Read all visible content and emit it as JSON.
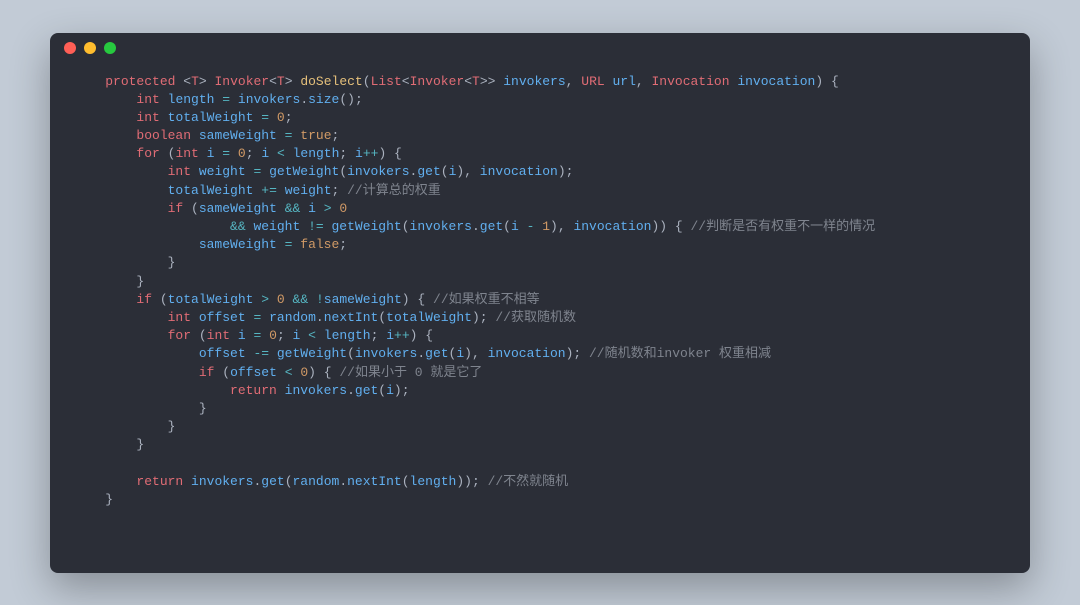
{
  "window": {
    "dots": {
      "red": "#ff5f56",
      "yellow": "#ffbd2e",
      "green": "#27c93f"
    }
  },
  "code": {
    "lines": [
      {
        "indent": 1,
        "tokens": [
          {
            "t": "kw",
            "v": "protected"
          },
          {
            "t": "sp",
            "v": " "
          },
          {
            "t": "punct",
            "v": "<"
          },
          {
            "t": "type",
            "v": "T"
          },
          {
            "t": "punct",
            "v": "> "
          },
          {
            "t": "type",
            "v": "Invoker"
          },
          {
            "t": "punct",
            "v": "<"
          },
          {
            "t": "type",
            "v": "T"
          },
          {
            "t": "punct",
            "v": "> "
          },
          {
            "t": "fn",
            "v": "doSelect"
          },
          {
            "t": "paren",
            "v": "("
          },
          {
            "t": "type",
            "v": "List"
          },
          {
            "t": "punct",
            "v": "<"
          },
          {
            "t": "type",
            "v": "Invoker"
          },
          {
            "t": "punct",
            "v": "<"
          },
          {
            "t": "type",
            "v": "T"
          },
          {
            "t": "punct",
            "v": ">> "
          },
          {
            "t": "var",
            "v": "invokers"
          },
          {
            "t": "punct",
            "v": ", "
          },
          {
            "t": "type",
            "v": "URL"
          },
          {
            "t": "sp",
            "v": " "
          },
          {
            "t": "var",
            "v": "url"
          },
          {
            "t": "punct",
            "v": ", "
          },
          {
            "t": "type",
            "v": "Invocation"
          },
          {
            "t": "sp",
            "v": " "
          },
          {
            "t": "var",
            "v": "invocation"
          },
          {
            "t": "paren",
            "v": ") {"
          }
        ]
      },
      {
        "indent": 2,
        "tokens": [
          {
            "t": "kw",
            "v": "int"
          },
          {
            "t": "sp",
            "v": " "
          },
          {
            "t": "var",
            "v": "length"
          },
          {
            "t": "sp",
            "v": " "
          },
          {
            "t": "op",
            "v": "="
          },
          {
            "t": "sp",
            "v": " "
          },
          {
            "t": "var",
            "v": "invokers"
          },
          {
            "t": "punct",
            "v": "."
          },
          {
            "t": "call",
            "v": "size"
          },
          {
            "t": "paren",
            "v": "();"
          }
        ]
      },
      {
        "indent": 2,
        "tokens": [
          {
            "t": "kw",
            "v": "int"
          },
          {
            "t": "sp",
            "v": " "
          },
          {
            "t": "var",
            "v": "totalWeight"
          },
          {
            "t": "sp",
            "v": " "
          },
          {
            "t": "op",
            "v": "="
          },
          {
            "t": "sp",
            "v": " "
          },
          {
            "t": "num",
            "v": "0"
          },
          {
            "t": "punct",
            "v": ";"
          }
        ]
      },
      {
        "indent": 2,
        "tokens": [
          {
            "t": "kw",
            "v": "boolean"
          },
          {
            "t": "sp",
            "v": " "
          },
          {
            "t": "var",
            "v": "sameWeight"
          },
          {
            "t": "sp",
            "v": " "
          },
          {
            "t": "op",
            "v": "="
          },
          {
            "t": "sp",
            "v": " "
          },
          {
            "t": "bool",
            "v": "true"
          },
          {
            "t": "punct",
            "v": ";"
          }
        ]
      },
      {
        "indent": 2,
        "tokens": [
          {
            "t": "kw",
            "v": "for"
          },
          {
            "t": "sp",
            "v": " "
          },
          {
            "t": "paren",
            "v": "("
          },
          {
            "t": "kw",
            "v": "int"
          },
          {
            "t": "sp",
            "v": " "
          },
          {
            "t": "var",
            "v": "i"
          },
          {
            "t": "sp",
            "v": " "
          },
          {
            "t": "op",
            "v": "="
          },
          {
            "t": "sp",
            "v": " "
          },
          {
            "t": "num",
            "v": "0"
          },
          {
            "t": "punct",
            "v": "; "
          },
          {
            "t": "var",
            "v": "i"
          },
          {
            "t": "sp",
            "v": " "
          },
          {
            "t": "op",
            "v": "<"
          },
          {
            "t": "sp",
            "v": " "
          },
          {
            "t": "var",
            "v": "length"
          },
          {
            "t": "punct",
            "v": "; "
          },
          {
            "t": "var",
            "v": "i"
          },
          {
            "t": "op",
            "v": "++"
          },
          {
            "t": "paren",
            "v": ") {"
          }
        ]
      },
      {
        "indent": 3,
        "tokens": [
          {
            "t": "kw",
            "v": "int"
          },
          {
            "t": "sp",
            "v": " "
          },
          {
            "t": "var",
            "v": "weight"
          },
          {
            "t": "sp",
            "v": " "
          },
          {
            "t": "op",
            "v": "="
          },
          {
            "t": "sp",
            "v": " "
          },
          {
            "t": "call",
            "v": "getWeight"
          },
          {
            "t": "paren",
            "v": "("
          },
          {
            "t": "var",
            "v": "invokers"
          },
          {
            "t": "punct",
            "v": "."
          },
          {
            "t": "call",
            "v": "get"
          },
          {
            "t": "paren",
            "v": "("
          },
          {
            "t": "var",
            "v": "i"
          },
          {
            "t": "paren",
            "v": "), "
          },
          {
            "t": "var",
            "v": "invocation"
          },
          {
            "t": "paren",
            "v": ");"
          }
        ]
      },
      {
        "indent": 3,
        "tokens": [
          {
            "t": "var",
            "v": "totalWeight"
          },
          {
            "t": "sp",
            "v": " "
          },
          {
            "t": "op",
            "v": "+="
          },
          {
            "t": "sp",
            "v": " "
          },
          {
            "t": "var",
            "v": "weight"
          },
          {
            "t": "punct",
            "v": "; "
          },
          {
            "t": "comment",
            "v": "//计算总的权重"
          }
        ]
      },
      {
        "indent": 3,
        "tokens": [
          {
            "t": "kw",
            "v": "if"
          },
          {
            "t": "sp",
            "v": " "
          },
          {
            "t": "paren",
            "v": "("
          },
          {
            "t": "var",
            "v": "sameWeight"
          },
          {
            "t": "sp",
            "v": " "
          },
          {
            "t": "op",
            "v": "&&"
          },
          {
            "t": "sp",
            "v": " "
          },
          {
            "t": "var",
            "v": "i"
          },
          {
            "t": "sp",
            "v": " "
          },
          {
            "t": "op",
            "v": ">"
          },
          {
            "t": "sp",
            "v": " "
          },
          {
            "t": "num",
            "v": "0"
          }
        ]
      },
      {
        "indent": 5,
        "tokens": [
          {
            "t": "op",
            "v": "&&"
          },
          {
            "t": "sp",
            "v": " "
          },
          {
            "t": "var",
            "v": "weight"
          },
          {
            "t": "sp",
            "v": " "
          },
          {
            "t": "op",
            "v": "!="
          },
          {
            "t": "sp",
            "v": " "
          },
          {
            "t": "call",
            "v": "getWeight"
          },
          {
            "t": "paren",
            "v": "("
          },
          {
            "t": "var",
            "v": "invokers"
          },
          {
            "t": "punct",
            "v": "."
          },
          {
            "t": "call",
            "v": "get"
          },
          {
            "t": "paren",
            "v": "("
          },
          {
            "t": "var",
            "v": "i"
          },
          {
            "t": "sp",
            "v": " "
          },
          {
            "t": "op",
            "v": "-"
          },
          {
            "t": "sp",
            "v": " "
          },
          {
            "t": "num",
            "v": "1"
          },
          {
            "t": "paren",
            "v": "), "
          },
          {
            "t": "var",
            "v": "invocation"
          },
          {
            "t": "paren",
            "v": ")) { "
          },
          {
            "t": "comment",
            "v": "//判断是否有权重不一样的情况"
          }
        ]
      },
      {
        "indent": 4,
        "tokens": [
          {
            "t": "var",
            "v": "sameWeight"
          },
          {
            "t": "sp",
            "v": " "
          },
          {
            "t": "op",
            "v": "="
          },
          {
            "t": "sp",
            "v": " "
          },
          {
            "t": "bool",
            "v": "false"
          },
          {
            "t": "punct",
            "v": ";"
          }
        ]
      },
      {
        "indent": 3,
        "tokens": [
          {
            "t": "paren",
            "v": "}"
          }
        ]
      },
      {
        "indent": 2,
        "tokens": [
          {
            "t": "paren",
            "v": "}"
          }
        ]
      },
      {
        "indent": 2,
        "tokens": [
          {
            "t": "kw",
            "v": "if"
          },
          {
            "t": "sp",
            "v": " "
          },
          {
            "t": "paren",
            "v": "("
          },
          {
            "t": "var",
            "v": "totalWeight"
          },
          {
            "t": "sp",
            "v": " "
          },
          {
            "t": "op",
            "v": ">"
          },
          {
            "t": "sp",
            "v": " "
          },
          {
            "t": "num",
            "v": "0"
          },
          {
            "t": "sp",
            "v": " "
          },
          {
            "t": "op",
            "v": "&&"
          },
          {
            "t": "sp",
            "v": " "
          },
          {
            "t": "op",
            "v": "!"
          },
          {
            "t": "var",
            "v": "sameWeight"
          },
          {
            "t": "paren",
            "v": ") { "
          },
          {
            "t": "comment",
            "v": "//如果权重不相等"
          }
        ]
      },
      {
        "indent": 3,
        "tokens": [
          {
            "t": "kw",
            "v": "int"
          },
          {
            "t": "sp",
            "v": " "
          },
          {
            "t": "var",
            "v": "offset"
          },
          {
            "t": "sp",
            "v": " "
          },
          {
            "t": "op",
            "v": "="
          },
          {
            "t": "sp",
            "v": " "
          },
          {
            "t": "var",
            "v": "random"
          },
          {
            "t": "punct",
            "v": "."
          },
          {
            "t": "call",
            "v": "nextInt"
          },
          {
            "t": "paren",
            "v": "("
          },
          {
            "t": "var",
            "v": "totalWeight"
          },
          {
            "t": "paren",
            "v": "); "
          },
          {
            "t": "comment",
            "v": "//获取随机数"
          }
        ]
      },
      {
        "indent": 3,
        "tokens": [
          {
            "t": "kw",
            "v": "for"
          },
          {
            "t": "sp",
            "v": " "
          },
          {
            "t": "paren",
            "v": "("
          },
          {
            "t": "kw",
            "v": "int"
          },
          {
            "t": "sp",
            "v": " "
          },
          {
            "t": "var",
            "v": "i"
          },
          {
            "t": "sp",
            "v": " "
          },
          {
            "t": "op",
            "v": "="
          },
          {
            "t": "sp",
            "v": " "
          },
          {
            "t": "num",
            "v": "0"
          },
          {
            "t": "punct",
            "v": "; "
          },
          {
            "t": "var",
            "v": "i"
          },
          {
            "t": "sp",
            "v": " "
          },
          {
            "t": "op",
            "v": "<"
          },
          {
            "t": "sp",
            "v": " "
          },
          {
            "t": "var",
            "v": "length"
          },
          {
            "t": "punct",
            "v": "; "
          },
          {
            "t": "var",
            "v": "i"
          },
          {
            "t": "op",
            "v": "++"
          },
          {
            "t": "paren",
            "v": ") {"
          }
        ]
      },
      {
        "indent": 4,
        "tokens": [
          {
            "t": "var",
            "v": "offset"
          },
          {
            "t": "sp",
            "v": " "
          },
          {
            "t": "op",
            "v": "-="
          },
          {
            "t": "sp",
            "v": " "
          },
          {
            "t": "call",
            "v": "getWeight"
          },
          {
            "t": "paren",
            "v": "("
          },
          {
            "t": "var",
            "v": "invokers"
          },
          {
            "t": "punct",
            "v": "."
          },
          {
            "t": "call",
            "v": "get"
          },
          {
            "t": "paren",
            "v": "("
          },
          {
            "t": "var",
            "v": "i"
          },
          {
            "t": "paren",
            "v": "), "
          },
          {
            "t": "var",
            "v": "invocation"
          },
          {
            "t": "paren",
            "v": "); "
          },
          {
            "t": "comment",
            "v": "//随机数和invoker 权重相减"
          }
        ]
      },
      {
        "indent": 4,
        "tokens": [
          {
            "t": "kw",
            "v": "if"
          },
          {
            "t": "sp",
            "v": " "
          },
          {
            "t": "paren",
            "v": "("
          },
          {
            "t": "var",
            "v": "offset"
          },
          {
            "t": "sp",
            "v": " "
          },
          {
            "t": "op",
            "v": "<"
          },
          {
            "t": "sp",
            "v": " "
          },
          {
            "t": "num",
            "v": "0"
          },
          {
            "t": "paren",
            "v": ") { "
          },
          {
            "t": "comment",
            "v": "//如果小于 0 就是它了"
          }
        ]
      },
      {
        "indent": 5,
        "tokens": [
          {
            "t": "kw",
            "v": "return"
          },
          {
            "t": "sp",
            "v": " "
          },
          {
            "t": "var",
            "v": "invokers"
          },
          {
            "t": "punct",
            "v": "."
          },
          {
            "t": "call",
            "v": "get"
          },
          {
            "t": "paren",
            "v": "("
          },
          {
            "t": "var",
            "v": "i"
          },
          {
            "t": "paren",
            "v": ");"
          }
        ]
      },
      {
        "indent": 4,
        "tokens": [
          {
            "t": "paren",
            "v": "}"
          }
        ]
      },
      {
        "indent": 3,
        "tokens": [
          {
            "t": "paren",
            "v": "}"
          }
        ]
      },
      {
        "indent": 2,
        "tokens": [
          {
            "t": "paren",
            "v": "}"
          }
        ]
      },
      {
        "indent": 0,
        "tokens": []
      },
      {
        "indent": 2,
        "tokens": [
          {
            "t": "kw",
            "v": "return"
          },
          {
            "t": "sp",
            "v": " "
          },
          {
            "t": "var",
            "v": "invokers"
          },
          {
            "t": "punct",
            "v": "."
          },
          {
            "t": "call",
            "v": "get"
          },
          {
            "t": "paren",
            "v": "("
          },
          {
            "t": "var",
            "v": "random"
          },
          {
            "t": "punct",
            "v": "."
          },
          {
            "t": "call",
            "v": "nextInt"
          },
          {
            "t": "paren",
            "v": "("
          },
          {
            "t": "var",
            "v": "length"
          },
          {
            "t": "paren",
            "v": ")); "
          },
          {
            "t": "comment",
            "v": "//不然就随机"
          }
        ]
      },
      {
        "indent": 1,
        "tokens": [
          {
            "t": "paren",
            "v": "}"
          }
        ]
      }
    ]
  }
}
